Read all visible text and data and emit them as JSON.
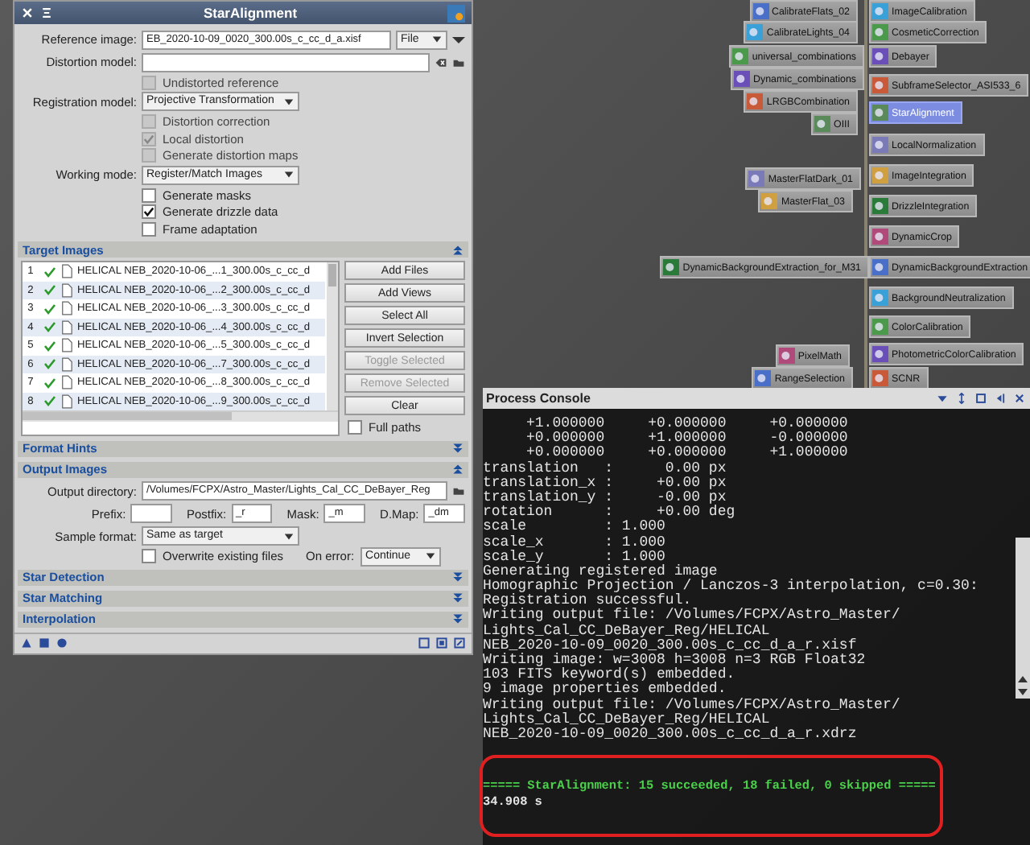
{
  "panel": {
    "title": "StarAlignment",
    "reference_image": {
      "label": "Reference image:",
      "value": "EB_2020-10-09_0020_300.00s_c_cc_d_a.xisf",
      "source": "File"
    },
    "distortion_model": {
      "label": "Distortion model:"
    },
    "options_1": [
      {
        "label": "Undistorted reference",
        "checked": false,
        "disabled": true
      }
    ],
    "registration_model": {
      "label": "Registration model:",
      "value": "Projective Transformation"
    },
    "options_2": [
      {
        "label": "Distortion correction",
        "checked": false,
        "disabled": true
      },
      {
        "label": "Local distortion",
        "checked": true,
        "disabled": true
      },
      {
        "label": "Generate distortion maps",
        "checked": false,
        "disabled": true
      }
    ],
    "working_mode": {
      "label": "Working mode:",
      "value": "Register/Match Images"
    },
    "options_3": [
      {
        "label": "Generate masks",
        "checked": false,
        "disabled": false
      },
      {
        "label": "Generate drizzle data",
        "checked": true,
        "disabled": false
      },
      {
        "label": "Frame adaptation",
        "checked": false,
        "disabled": false
      }
    ],
    "sections": [
      {
        "kind": "target_images",
        "title": "Target Images",
        "expanded": true,
        "rows": [
          {
            "index": "1",
            "checked": true,
            "file": "HELICAL NEB_2020-10-06_...1_300.00s_c_cc_d"
          },
          {
            "index": "2",
            "checked": true,
            "file": "HELICAL NEB_2020-10-06_...2_300.00s_c_cc_d"
          },
          {
            "index": "3",
            "checked": true,
            "file": "HELICAL NEB_2020-10-06_...3_300.00s_c_cc_d"
          },
          {
            "index": "4",
            "checked": true,
            "file": "HELICAL NEB_2020-10-06_...4_300.00s_c_cc_d"
          },
          {
            "index": "5",
            "checked": true,
            "file": "HELICAL NEB_2020-10-06_...5_300.00s_c_cc_d"
          },
          {
            "index": "6",
            "checked": true,
            "file": "HELICAL NEB_2020-10-06_...7_300.00s_c_cc_d"
          },
          {
            "index": "7",
            "checked": true,
            "file": "HELICAL NEB_2020-10-06_...8_300.00s_c_cc_d"
          },
          {
            "index": "8",
            "checked": true,
            "file": "HELICAL NEB_2020-10-06_...9_300.00s_c_cc_d"
          }
        ],
        "buttons": [
          {
            "label": "Add Files",
            "disabled": false
          },
          {
            "label": "Add Views",
            "disabled": false
          },
          {
            "label": "Select All",
            "disabled": false
          },
          {
            "label": "Invert Selection",
            "disabled": false
          },
          {
            "label": "Toggle Selected",
            "disabled": true
          },
          {
            "label": "Remove Selected",
            "disabled": true
          },
          {
            "label": "Clear",
            "disabled": false
          }
        ],
        "full_paths": {
          "label": "Full paths",
          "checked": false
        }
      },
      {
        "title": "Format Hints",
        "expanded": false
      },
      {
        "kind": "output_images",
        "title": "Output Images",
        "expanded": true,
        "output_directory": {
          "label": "Output directory:",
          "value": "/Volumes/FCPX/Astro_Master/Lights_Cal_CC_DeBayer_Reg"
        },
        "affixes": [
          {
            "label": "Prefix:"
          },
          {
            "label": "Postfix:",
            "value": "_r"
          },
          {
            "label": "Mask:",
            "value": "_m"
          },
          {
            "label": "D.Map:",
            "value": "_dm"
          }
        ],
        "sample_format": {
          "label": "Sample format:",
          "value": "Same as target"
        },
        "overwrite": {
          "label": "Overwrite existing files",
          "checked": false
        },
        "on_error": {
          "label": "On error:",
          "value": "Continue"
        }
      },
      {
        "title": "Star Detection",
        "expanded": false
      },
      {
        "title": "Star Matching",
        "expanded": false
      },
      {
        "title": "Interpolation",
        "expanded": false
      }
    ]
  },
  "nodes": [
    {
      "label": "CalibrateFlats_02",
      "selected": false
    },
    {
      "label": "CalibrateLights_04",
      "selected": false
    },
    {
      "label": "universal_combinations",
      "selected": false
    },
    {
      "label": "Dynamic_combinations",
      "selected": false
    },
    {
      "label": "LRGBCombination",
      "selected": false
    },
    {
      "label": "OIII",
      "selected": false
    },
    {
      "label": "MasterFlatDark_01",
      "selected": false
    },
    {
      "label": "MasterFlat_03",
      "selected": false
    },
    {
      "label": "DynamicBackgroundExtraction_for_M31",
      "selected": false
    },
    {
      "label": "PixelMath",
      "selected": false
    },
    {
      "label": "RangeSelection",
      "selected": false
    },
    {
      "label": "ImageCalibration",
      "selected": false
    },
    {
      "label": "CosmeticCorrection",
      "selected": false
    },
    {
      "label": "Debayer",
      "selected": false
    },
    {
      "label": "SubframeSelector_ASI533_6",
      "selected": false
    },
    {
      "label": "StarAlignment",
      "selected": true
    },
    {
      "label": "LocalNormalization",
      "selected": false
    },
    {
      "label": "ImageIntegration",
      "selected": false
    },
    {
      "label": "DrizzleIntegration",
      "selected": false
    },
    {
      "label": "DynamicCrop",
      "selected": false
    },
    {
      "label": "DynamicBackgroundExtraction",
      "selected": false
    },
    {
      "label": "BackgroundNeutralization",
      "selected": false
    },
    {
      "label": "ColorCalibration",
      "selected": false
    },
    {
      "label": "PhotometricColorCalibration",
      "selected": false
    },
    {
      "label": "SCNR",
      "selected": false
    }
  ],
  "console": {
    "title": "Process Console",
    "lines": [
      "     +1.000000     +0.000000     +0.000000",
      "     +0.000000     +1.000000     -0.000000",
      "     +0.000000     +0.000000     +1.000000",
      "translation   :      0.00 px",
      "translation_x :     +0.00 px",
      "translation_y :     -0.00 px",
      "rotation      :     +0.00 deg",
      "scale         : 1.000",
      "scale_x       : 1.000",
      "scale_y       : 1.000",
      "Generating registered image",
      "Homographic Projection / Lanczos-3 interpolation, c=0.30:",
      "Registration successful.",
      "Writing output file: /Volumes/FCPX/Astro_Master/",
      "Lights_Cal_CC_DeBayer_Reg/HELICAL",
      "NEB_2020-10-09_0020_300.00s_c_cc_d_a_r.xisf",
      "Writing image: w=3008 h=3008 n=3 RGB Float32",
      "103 FITS keyword(s) embedded.",
      "9 image properties embedded.",
      "Writing output file: /Volumes/FCPX/Astro_Master/",
      "Lights_Cal_CC_DeBayer_Reg/HELICAL",
      "NEB_2020-10-09_0020_300.00s_c_cc_d_a_r.xdrz"
    ],
    "highlighted": [
      {
        "kind": "success",
        "text": "===== StarAlignment: 15 succeeded, 18 failed, 0 skipped ====="
      },
      {
        "kind": "normal",
        "text": "34.908 s"
      }
    ]
  }
}
